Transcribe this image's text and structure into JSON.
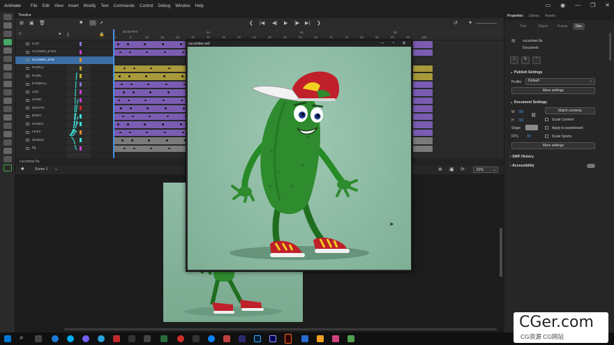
{
  "app_name": "Animate",
  "menu": [
    "File",
    "Edit",
    "View",
    "Insert",
    "Modify",
    "Text",
    "Commands",
    "Control",
    "Debug",
    "Window",
    "Help"
  ],
  "timeline": {
    "tab_label": "Timeline",
    "fps_label": "30.00",
    "fps_unit": "FPS",
    "frame_ticks": [
      "1",
      "5",
      "10",
      "15",
      "20",
      "25",
      "30",
      "35",
      "40",
      "45",
      "50",
      "55",
      "60",
      "65",
      "70",
      "75",
      "80",
      "85",
      "90",
      "95",
      "100"
    ],
    "sec_marks": [
      "1s",
      "2s",
      "3s"
    ],
    "layers": [
      {
        "name": "CAP",
        "color": "#8a6fd0",
        "bar": "purple"
      },
      {
        "name": "CLOSED_EYE2",
        "color": "#cc3ccc",
        "bar": "purple"
      },
      {
        "name": "CLOSED_EYE",
        "color": "#e08a2a",
        "bar": "none",
        "selected": true
      },
      {
        "name": "PUPIL2",
        "color": "#b69a2a",
        "bar": "olive"
      },
      {
        "name": "PUPIL",
        "color": "#c0b030",
        "bar": "olive"
      },
      {
        "name": "EYEBALL",
        "color": "#8a6fd0",
        "bar": "purple"
      },
      {
        "name": "LEG",
        "color": "#cc3ccc",
        "bar": "purple"
      },
      {
        "name": "HAND",
        "color": "#cc3ccc",
        "bar": "purple"
      },
      {
        "name": "MOUTH",
        "color": "#d02a2a",
        "bar": "purple"
      },
      {
        "name": "BODY",
        "color": "#3ce0d8",
        "bar": "purple"
      },
      {
        "name": "HAND2",
        "color": "#3ce0d8",
        "bar": "purple"
      },
      {
        "name": "LEG2",
        "color": "#e08a2a",
        "bar": "purple"
      },
      {
        "name": "shadow",
        "color": "#3ce0d8",
        "bar": "grey"
      },
      {
        "name": "bg",
        "color": "#cc3ccc",
        "bar": "grey"
      }
    ],
    "scene_label": "Scene 1"
  },
  "document": {
    "tab_label": "cucumber.fla",
    "scene": "Scene 1",
    "zoom": "62%"
  },
  "swf_window": {
    "title": "cucumber.swf"
  },
  "properties": {
    "panel_tabs": [
      "Properties",
      "Library",
      "Assets"
    ],
    "sub_tabs": [
      "Tool",
      "Object",
      "Frame",
      "Doc"
    ],
    "active_sub_tab": "Doc",
    "doc_name": "cucumber.fla",
    "doc_type": "Document",
    "publish_settings": {
      "header": "Publish Settings",
      "profile_label": "Profile",
      "profile_value": "Default",
      "more_settings": "More settings"
    },
    "document_settings": {
      "header": "Document Settings",
      "w_label": "W",
      "w_value": "700",
      "h_label": "H",
      "h_value": "700",
      "match_contents": "Match contents",
      "scale_content": "Scale Content",
      "apply_pasteboard": "Apply to pasteboard",
      "scale_spans": "Scale Spans",
      "stage_label": "Stage",
      "fps_label": "FPS",
      "fps_value": "30",
      "more_settings": "More settings"
    },
    "swf_history": "SWF History",
    "accessibility": "Accessibility"
  },
  "watermark": {
    "big": "CGer.com",
    "small": "CG资源 CG网站"
  },
  "colors": {
    "timeline_purple": "#7b5cb3",
    "timeline_olive": "#a89a3a",
    "timeline_grey": "#7a7a7a",
    "selection_blue": "#3a6ea5",
    "cucumber_green": "#2e8b2e",
    "cap_red": "#c0202a"
  }
}
